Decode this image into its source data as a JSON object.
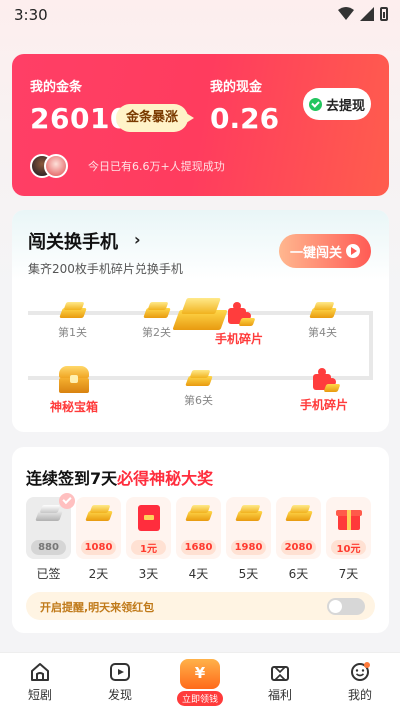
{
  "status": {
    "time": "3:30"
  },
  "wallet": {
    "gold_label": "我的金条",
    "gold_value": "26010",
    "surge_label": "金条暴涨",
    "cash_label": "我的现金",
    "cash_value": "0.26",
    "withdraw_label": "去提现",
    "notice": "今日已有6.6万+人提现成功"
  },
  "challenge": {
    "title": "闯关换手机",
    "arrow": "›",
    "subtitle": "集齐200枚手机碎片兑换手机",
    "button": "一键闯关",
    "stages": [
      "第1关",
      "第2关",
      "手机碎片",
      "第4关",
      "神秘宝箱",
      "第6关",
      "手机碎片"
    ]
  },
  "checkin": {
    "title_prefix": "连续签到7天",
    "title_highlight": "必得神秘大奖",
    "days": [
      {
        "reward": "880",
        "label": "已签"
      },
      {
        "reward": "1080",
        "label": "2天"
      },
      {
        "reward": "1元",
        "label": "3天"
      },
      {
        "reward": "1680",
        "label": "4天"
      },
      {
        "reward": "1980",
        "label": "5天"
      },
      {
        "reward": "2080",
        "label": "6天"
      },
      {
        "reward": "10元",
        "label": "7天"
      }
    ],
    "remind": "开启提醒,明天来领红包"
  },
  "tabbar": {
    "tabs": [
      "短剧",
      "发现",
      "立即领钱",
      "福利",
      "我的"
    ]
  }
}
